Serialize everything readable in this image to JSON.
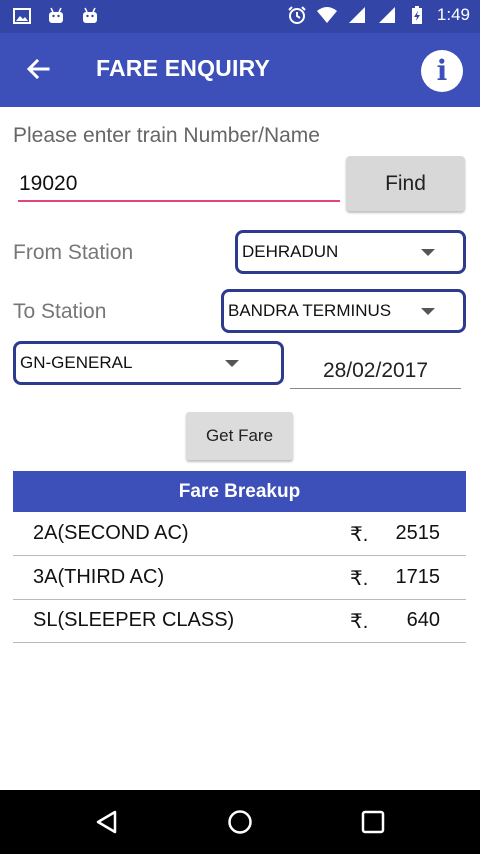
{
  "status_bar": {
    "time": "1:49"
  },
  "app_bar": {
    "title": "FARE ENQUIRY"
  },
  "form": {
    "prompt": "Please enter train Number/Name",
    "train_number_value": "19020",
    "find_label": "Find",
    "from_label": "From Station",
    "from_value": "DEHRADUN",
    "to_label": "To Station",
    "to_value": "BANDRA TERMINUS",
    "quota_value": "GN-GENERAL",
    "date_value": "28/02/2017",
    "get_fare_label": "Get Fare"
  },
  "fare_breakup": {
    "header": "Fare Breakup",
    "rows": [
      {
        "class": "2A(SECOND AC)",
        "currency": "₹.",
        "amount": "2515"
      },
      {
        "class": "3A(THIRD AC)",
        "currency": "₹.",
        "amount": "1715"
      },
      {
        "class": "SL(SLEEPER CLASS)",
        "currency": "₹.",
        "amount": "640"
      }
    ]
  },
  "colors": {
    "primary": "#3d4fb8",
    "status_bar": "#3346a8",
    "input_underline": "#e0457b",
    "select_border": "#2e3a8e"
  },
  "icons": {
    "status_left": [
      "image-icon",
      "android-icon",
      "android-icon"
    ],
    "status_right": [
      "alarm-icon",
      "wifi-icon",
      "signal-icon",
      "signal-icon",
      "battery-charging-icon"
    ],
    "back": "arrow-back-icon",
    "info": "info-icon",
    "nav": [
      "nav-back-icon",
      "nav-home-icon",
      "nav-recents-icon"
    ]
  }
}
